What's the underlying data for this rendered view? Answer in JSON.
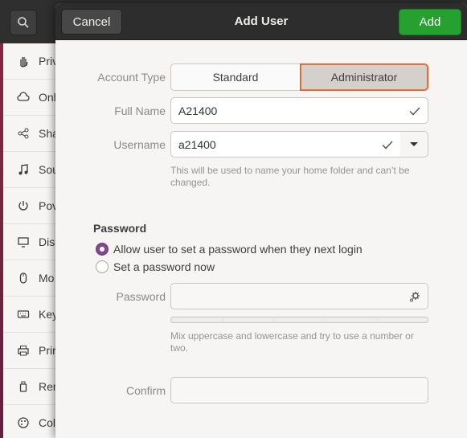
{
  "sidebar": {
    "items": [
      {
        "label": "Priv",
        "icon": "hand-icon"
      },
      {
        "label": "Onl",
        "icon": "cloud-icon"
      },
      {
        "label": "Sha",
        "icon": "share-icon"
      },
      {
        "label": "Sou",
        "icon": "music-note-icon"
      },
      {
        "label": "Pov",
        "icon": "power-icon"
      },
      {
        "label": "Dis",
        "icon": "display-icon"
      },
      {
        "label": "Mo",
        "icon": "mouse-icon"
      },
      {
        "label": "Key",
        "icon": "keyboard-icon"
      },
      {
        "label": "Prir",
        "icon": "printer-icon"
      },
      {
        "label": "Ren",
        "icon": "usb-icon"
      },
      {
        "label": "Col",
        "icon": "palette-icon"
      }
    ]
  },
  "dialog": {
    "title": "Add User",
    "cancel_label": "Cancel",
    "add_label": "Add",
    "account_type_label": "Account Type",
    "account_types": [
      "Standard",
      "Administrator"
    ],
    "account_type_selected": "Administrator",
    "full_name_label": "Full Name",
    "full_name_value": "A21400",
    "username_label": "Username",
    "username_value": "a21400",
    "username_hint": "This will be used to name your home folder and can’t be changed.",
    "password_section_title": "Password",
    "password_options": [
      "Allow user to set a password when they next login",
      "Set a password now"
    ],
    "password_option_selected": 0,
    "password_label": "Password",
    "password_value": "",
    "password_hint": "Mix uppercase and lowercase and try to use a number or two.",
    "confirm_label": "Confirm",
    "confirm_value": ""
  },
  "colors": {
    "accent_orange": "#e95420",
    "add_button_green": "#26a12f",
    "radio_purple": "#7e4a8e",
    "header_dark": "#2d2d2d"
  }
}
